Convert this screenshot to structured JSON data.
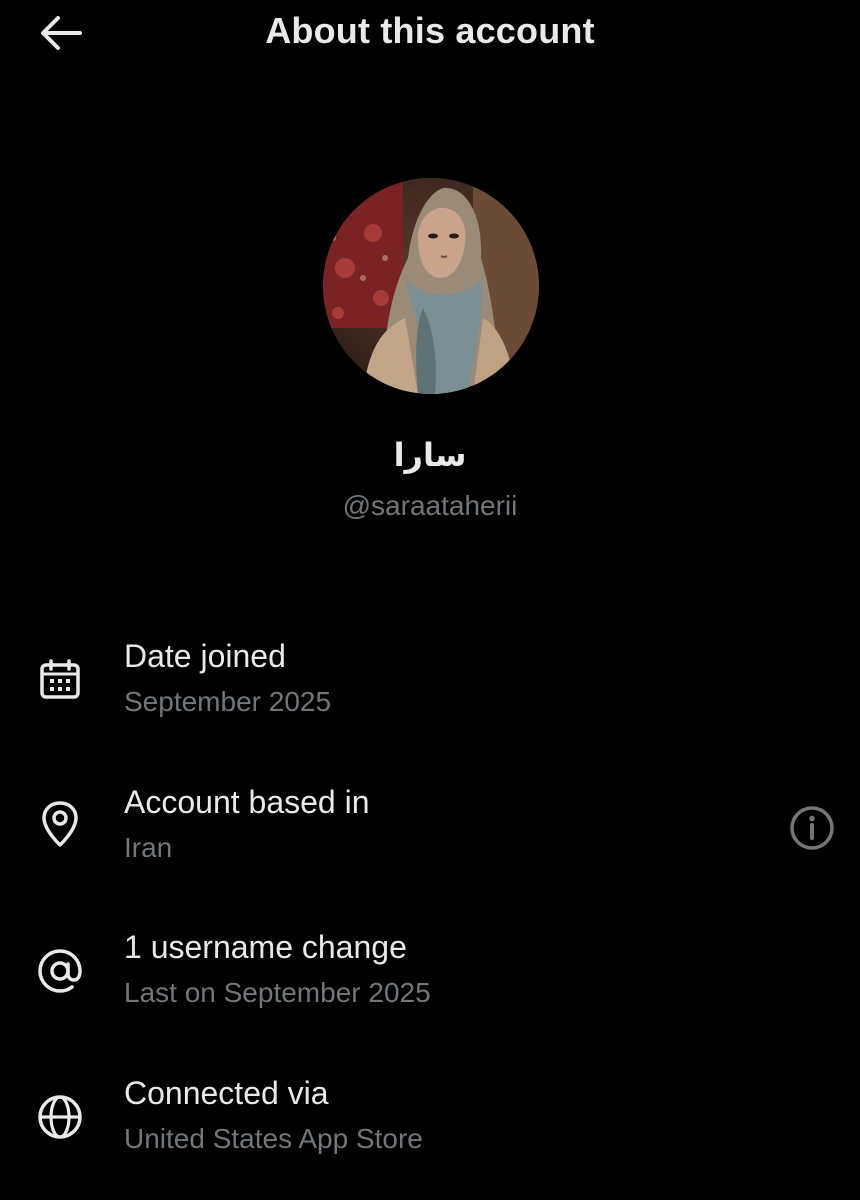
{
  "header": {
    "title": "About this account",
    "back_icon": "arrow-left-icon"
  },
  "profile": {
    "display_name": "سارا",
    "handle": "@saraataherii",
    "avatar": "profile-photo"
  },
  "rows": [
    {
      "icon": "calendar-icon",
      "title": "Date joined",
      "subtitle": "September 2025"
    },
    {
      "icon": "location-pin-icon",
      "title": "Account based in",
      "subtitle": "Iran",
      "action_icon": "info-icon"
    },
    {
      "icon": "at-sign-icon",
      "title": "1 username change",
      "subtitle": "Last on September 2025"
    },
    {
      "icon": "globe-icon",
      "title": "Connected via",
      "subtitle": "United States App Store"
    }
  ],
  "colors": {
    "background": "#000000",
    "primary_text": "#e7e9ea",
    "secondary_text": "#71767b"
  }
}
